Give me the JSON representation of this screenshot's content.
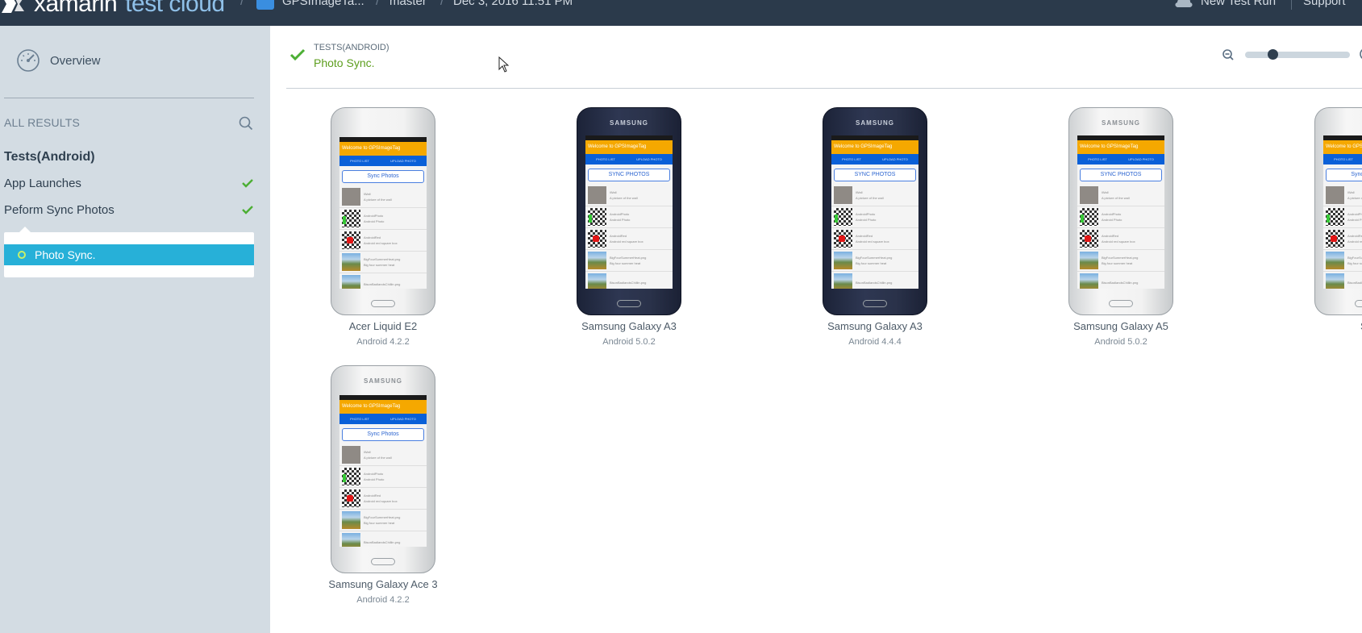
{
  "header": {
    "brand_primary": "xamarin",
    "brand_secondary": "test cloud",
    "breadcrumbs": [
      "GPSImageTa...",
      "master",
      "Dec 3, 2016 11:51 PM"
    ],
    "new_test_run": "New Test Run",
    "support": "Support"
  },
  "sidebar": {
    "overview": "Overview",
    "all_results": "ALL RESULTS",
    "group": "Tests(Android)",
    "items": [
      {
        "label": "App Launches",
        "status": "passed"
      },
      {
        "label": "Peform Sync Photos",
        "status": "passed"
      }
    ],
    "popup_selected": "Photo Sync."
  },
  "main": {
    "category": "TESTS(ANDROID)",
    "title": "Photo Sync."
  },
  "screen": {
    "welcome": "Welcome to GPSImageTag",
    "tab_list": "PHOTO LIST",
    "tab_upload": "UPLOAD PHOTO",
    "sync_caps": "SYNC PHOTOS",
    "sync_title": "Sync Photos",
    "rows": [
      {
        "name": "iWall",
        "desc": "A picture of the wall"
      },
      {
        "name": "AndroidPhoto",
        "desc": "Android Photo"
      },
      {
        "name": "AndroidRed",
        "desc": "Android red square box"
      },
      {
        "name": "BigFourSummerHeat.png",
        "desc": "Big four summer heat"
      },
      {
        "name": "BisonBadlandsChillin.png",
        "desc": ""
      }
    ]
  },
  "devices": [
    {
      "name": "Acer Liquid E2",
      "os": "Android 4.2.2",
      "brand": "",
      "sync": "title"
    },
    {
      "name": "Samsung Galaxy A3",
      "os": "Android 5.0.2",
      "brand": "SAMSUNG",
      "sync": "caps"
    },
    {
      "name": "Samsung Galaxy A3",
      "os": "Android 4.4.4",
      "brand": "SAMSUNG",
      "sync": "caps"
    },
    {
      "name": "Samsung Galaxy A5",
      "os": "Android 5.0.2",
      "brand": "SAMSUNG",
      "sync": "caps"
    },
    {
      "name": "Sa",
      "os": "",
      "brand": "",
      "sync": "title"
    },
    {
      "name": "Samsung Galaxy Ace 3",
      "os": "Android 4.2.2",
      "brand": "SAMSUNG",
      "sync": "title"
    }
  ],
  "colors": {
    "header_bg": "#2b3a4b",
    "sidebar_bg": "#d3dce3",
    "selected": "#27b0d8",
    "pass": "#5d9e1e"
  }
}
